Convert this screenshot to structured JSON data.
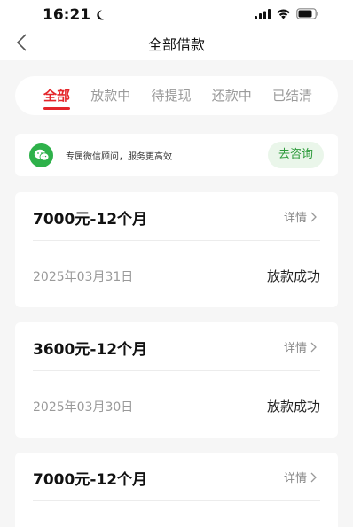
{
  "status_bar": {
    "time": "16:21"
  },
  "nav": {
    "title": "全部借款"
  },
  "tabs": [
    {
      "label": "全部",
      "active": true
    },
    {
      "label": "放款中",
      "active": false
    },
    {
      "label": "待提现",
      "active": false
    },
    {
      "label": "还款中",
      "active": false
    },
    {
      "label": "已结清",
      "active": false
    }
  ],
  "consult": {
    "text": "专属微信顾问，服务更高效",
    "button": "去咨询",
    "icon": "wechat-icon"
  },
  "loans": [
    {
      "amount": "7000元-12个月",
      "detail": "详情",
      "date": "2025年03月31日",
      "status": "放款成功"
    },
    {
      "amount": "3600元-12个月",
      "detail": "详情",
      "date": "2025年03月30日",
      "status": "放款成功"
    },
    {
      "amount": "7000元-12个月",
      "detail": "详情"
    }
  ],
  "colors": {
    "accent": "#e4262b",
    "wechat": "#2eb14a",
    "background": "#f6f6f6"
  }
}
